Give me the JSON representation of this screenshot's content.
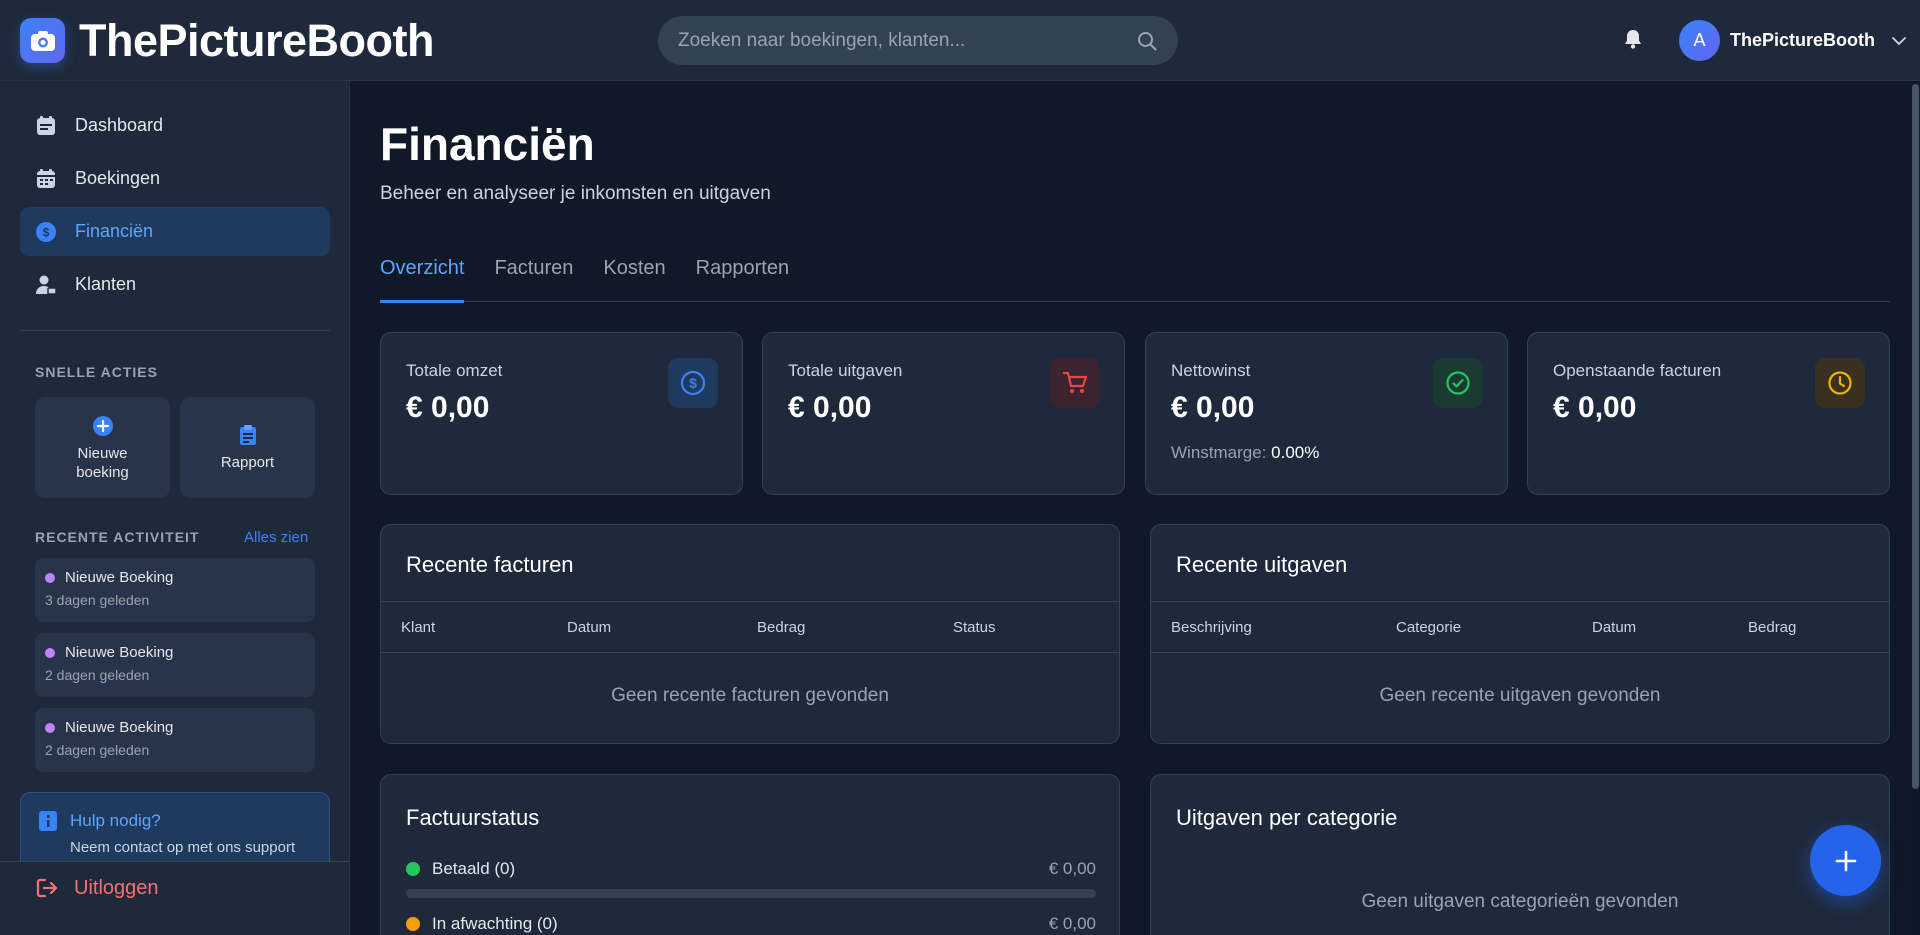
{
  "header": {
    "brand": "ThePictureBooth",
    "search_placeholder": "Zoeken naar boekingen, klanten...",
    "user_initial": "A",
    "user_name": "ThePictureBooth"
  },
  "sidebar": {
    "nav": [
      {
        "label": "Dashboard",
        "icon": "dashboard-icon"
      },
      {
        "label": "Boekingen",
        "icon": "calendar-icon"
      },
      {
        "label": "Financiën",
        "icon": "dollar-icon",
        "active": true
      },
      {
        "label": "Klanten",
        "icon": "user-icon"
      }
    ],
    "quick_actions_title": "SNELLE ACTIES",
    "quick_actions": [
      {
        "label": "Nieuwe boeking",
        "icon": "plus-circle-icon"
      },
      {
        "label": "Rapport",
        "icon": "clipboard-icon"
      }
    ],
    "recent_title": "RECENTE ACTIVITEIT",
    "see_all": "Alles zien",
    "activities": [
      {
        "title": "Nieuwe Boeking",
        "time": "3 dagen geleden"
      },
      {
        "title": "Nieuwe Boeking",
        "time": "2 dagen geleden"
      },
      {
        "title": "Nieuwe Boeking",
        "time": "2 dagen geleden"
      }
    ],
    "help": {
      "title": "Hulp nodig?",
      "text": "Neem contact op met ons support"
    },
    "logout": "Uitloggen"
  },
  "main": {
    "title": "Financiën",
    "subtitle": "Beheer en analyseer je inkomsten en uitgaven",
    "tabs": [
      "Overzicht",
      "Facturen",
      "Kosten",
      "Rapporten"
    ],
    "active_tab": 0,
    "stats": [
      {
        "label": "Totale omzet",
        "value": "€ 0,00",
        "icon": "dollar-icon",
        "color": "#3b82f6"
      },
      {
        "label": "Totale uitgaven",
        "value": "€ 0,00",
        "icon": "cart-icon",
        "color": "#ef4444"
      },
      {
        "label": "Nettowinst",
        "value": "€ 0,00",
        "icon": "check-circle-icon",
        "color": "#22c55e",
        "extra_label": "Winstmarge:",
        "extra_value": "0.00%"
      },
      {
        "label": "Openstaande facturen",
        "value": "€ 0,00",
        "icon": "clock-icon",
        "color": "#eab308"
      }
    ],
    "recent_invoices": {
      "title": "Recente facturen",
      "columns": [
        "Klant",
        "Datum",
        "Bedrag",
        "Status"
      ],
      "empty": "Geen recente facturen gevonden"
    },
    "recent_expenses": {
      "title": "Recente uitgaven",
      "columns": [
        "Beschrijving",
        "Categorie",
        "Datum",
        "Bedrag"
      ],
      "empty": "Geen recente uitgaven gevonden"
    },
    "invoice_status": {
      "title": "Factuurstatus",
      "rows": [
        {
          "label": "Betaald (0)",
          "amount": "€ 0,00",
          "color": "#22c55e",
          "progress": 0
        },
        {
          "label": "In afwachting (0)",
          "amount": "€ 0,00",
          "color": "#f59e0b",
          "progress": 0
        }
      ]
    },
    "expenses_by_category": {
      "title": "Uitgaven per categorie",
      "empty": "Geen uitgaven categorieën gevonden"
    }
  }
}
